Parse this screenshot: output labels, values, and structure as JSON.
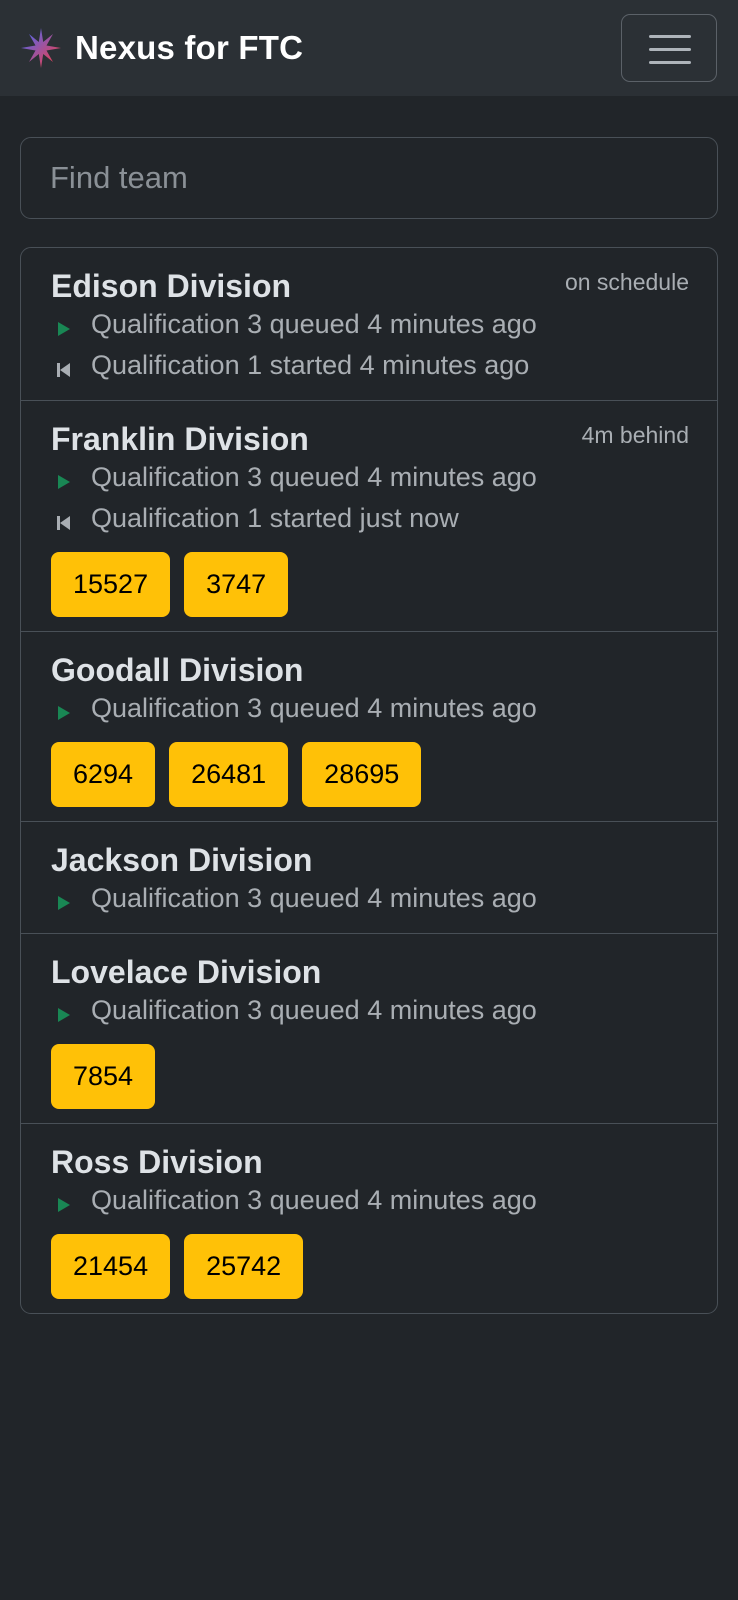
{
  "navbar": {
    "brand_name": "Nexus for FTC",
    "logo_icon": "star-burst-logo",
    "menu_icon": "hamburger-menu-icon"
  },
  "search": {
    "placeholder": "Find team",
    "value": ""
  },
  "colors": {
    "background": "#212529",
    "navbar": "#2b3035",
    "badge": "#ffc107",
    "play_icon": "#198754",
    "muted_text": "#a9aeb3"
  },
  "divisions": [
    {
      "name": "Edison Division",
      "status": "on schedule",
      "events": [
        {
          "icon": "play-icon",
          "text": "Qualification 3 queued 4 minutes ago"
        },
        {
          "icon": "skip-back-icon",
          "text": "Qualification 1 started 4 minutes ago"
        }
      ],
      "teams": []
    },
    {
      "name": "Franklin Division",
      "status": "4m behind",
      "events": [
        {
          "icon": "play-icon",
          "text": "Qualification 3 queued 4 minutes ago"
        },
        {
          "icon": "skip-back-icon",
          "text": "Qualification 1 started just now"
        }
      ],
      "teams": [
        "15527",
        "3747"
      ]
    },
    {
      "name": "Goodall Division",
      "status": "",
      "events": [
        {
          "icon": "play-icon",
          "text": "Qualification 3 queued 4 minutes ago"
        }
      ],
      "teams": [
        "6294",
        "26481",
        "28695"
      ]
    },
    {
      "name": "Jackson Division",
      "status": "",
      "events": [
        {
          "icon": "play-icon",
          "text": "Qualification 3 queued 4 minutes ago"
        }
      ],
      "teams": []
    },
    {
      "name": "Lovelace Division",
      "status": "",
      "events": [
        {
          "icon": "play-icon",
          "text": "Qualification 3 queued 4 minutes ago"
        }
      ],
      "teams": [
        "7854"
      ]
    },
    {
      "name": "Ross Division",
      "status": "",
      "events": [
        {
          "icon": "play-icon",
          "text": "Qualification 3 queued 4 minutes ago"
        }
      ],
      "teams": [
        "21454",
        "25742"
      ]
    }
  ]
}
